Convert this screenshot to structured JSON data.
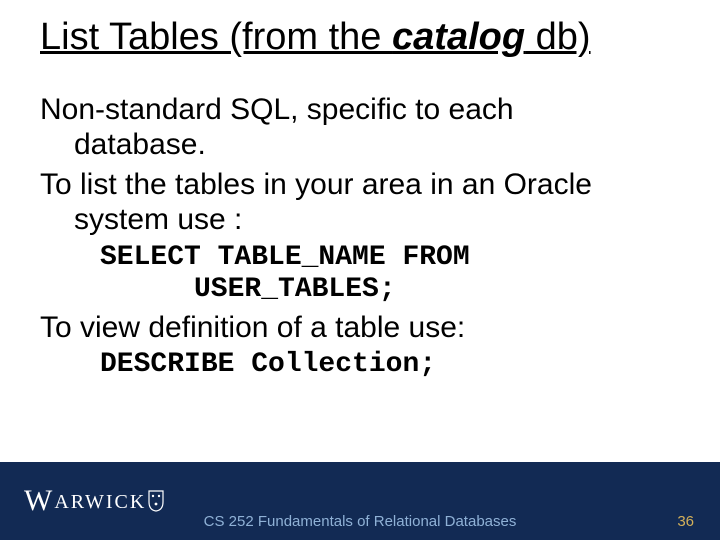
{
  "title": {
    "pre": "List Tables (from the ",
    "em": "catalog",
    "post": " db)"
  },
  "body": {
    "p1a": "Non-standard SQL, specific to each",
    "p1b": "database.",
    "p2a": "To list the tables in your area in an Oracle",
    "p2b": "system use :",
    "code1a": "SELECT TABLE_NAME FROM",
    "code1b": "USER_TABLES;",
    "p3": "To view definition of a table use:",
    "code2": "DESCRIBE Collection;"
  },
  "footer": {
    "course": "CS 252 Fundamentals of Relational Databases",
    "page": "36",
    "logo_word": "ARWICK",
    "logo_w": "W"
  }
}
